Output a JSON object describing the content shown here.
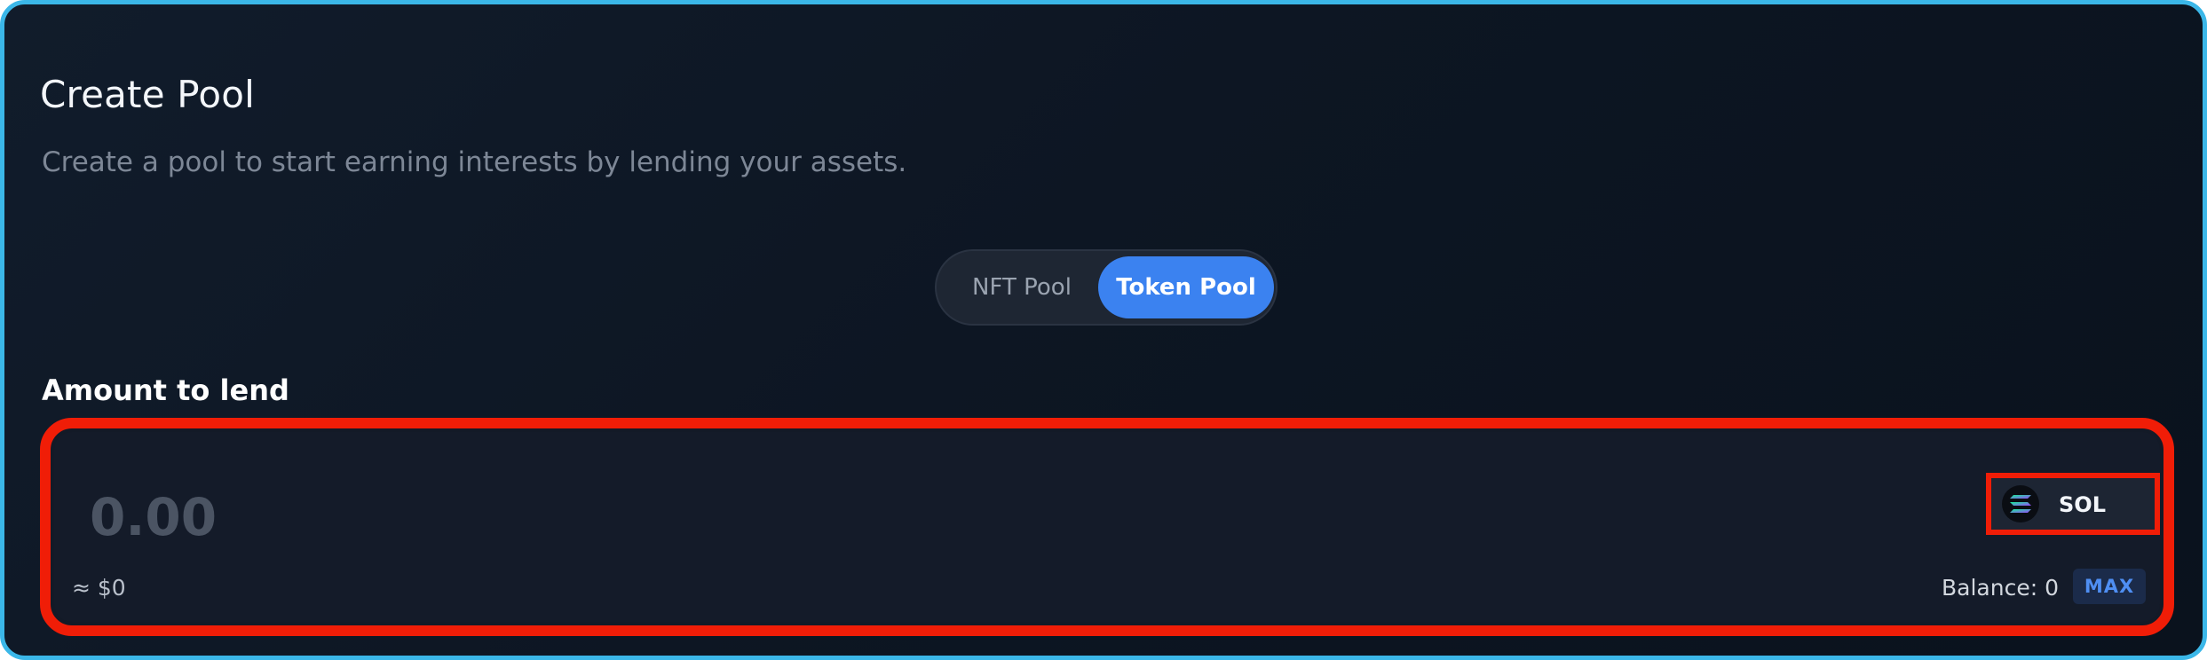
{
  "header": {
    "title": "Create Pool",
    "subtitle": "Create a pool to start earning interests by lending your assets."
  },
  "pool_type_toggle": {
    "options": [
      "NFT Pool",
      "Token Pool"
    ],
    "selected": "Token Pool"
  },
  "amount": {
    "label": "Amount to lend",
    "placeholder": "0.00",
    "value": "",
    "usd_value": "≈ $0",
    "token": {
      "symbol": "SOL",
      "icon": "solana-icon"
    },
    "balance_text": "Balance: 0",
    "max_label": "MAX"
  },
  "colors": {
    "accent": "#3b82f0",
    "highlight_border": "#f01d07",
    "frame_border": "#3bb7e8",
    "background": "#0d1623"
  }
}
